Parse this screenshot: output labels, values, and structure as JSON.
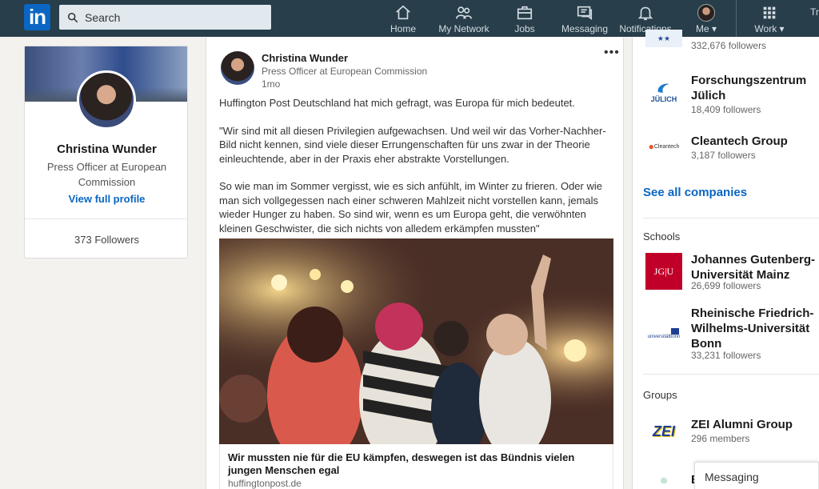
{
  "nav": {
    "search_placeholder": "Search",
    "items": [
      {
        "label": "Home"
      },
      {
        "label": "My Network"
      },
      {
        "label": "Jobs"
      },
      {
        "label": "Messaging"
      },
      {
        "label": "Notifications"
      },
      {
        "label": "Me"
      },
      {
        "label": "Work"
      }
    ],
    "cut_text": "Tr"
  },
  "profile": {
    "name": "Christina Wunder",
    "headline": "Press Officer at European Commission",
    "view_link": "View full profile",
    "followers": "373 Followers"
  },
  "post": {
    "author": "Christina Wunder",
    "author_title": "Press Officer at European Commission",
    "time": "1mo",
    "paragraphs": [
      "Huffington Post Deutschland hat mich gefragt, was Europa für mich bedeutet.",
      "\"Wir sind mit all diesen Privilegien aufgewachsen. Und weil wir das Vorher-Nachher-Bild nicht kennen, sind viele dieser Errungenschaften für uns zwar in der Theorie einleuchtende, aber in der Praxis eher abstrakte Vorstellungen.",
      "So wie man im Sommer vergisst, wie es sich anfühlt, im Winter zu frieren. Oder wie man sich vollgegessen nach einer schweren Mahlzeit nicht vorstellen kann, jemals wieder Hunger zu haben. So sind wir, wenn es um Europa geht, die verwöhnten kleinen Geschwister, die sich nichts von alledem erkämpfen mussten\""
    ],
    "article_title": "Wir mussten nie für die EU kämpfen, deswegen ist das Bündnis vielen jungen Menschen egal",
    "article_source": "huffingtonpost.de"
  },
  "rail": {
    "top_partial_followers": "332,676 followers",
    "companies": [
      {
        "name": "Forschungszentrum Jülich",
        "followers": "18,409 followers",
        "logo_text": "JÜLICH"
      },
      {
        "name": "Cleantech Group",
        "followers": "3,187 followers",
        "logo_text": "Cleantech"
      }
    ],
    "see_all": "See all companies",
    "schools_heading": "Schools",
    "schools": [
      {
        "name": "Johannes Gutenberg-Universität Mainz",
        "followers": "26,699 followers",
        "logo_text": "JG|U"
      },
      {
        "name": "Rheinische Friedrich-Wilhelms-Universität Bonn",
        "followers": "33,231 followers",
        "logo_text": "universitätbonn"
      }
    ],
    "groups_heading": "Groups",
    "groups": [
      {
        "name": "ZEI Alumni Group",
        "members": "296 members",
        "logo_text": "ZEI"
      }
    ],
    "partial_last": "E"
  },
  "messaging": {
    "label": "Messaging"
  },
  "colors": {
    "nav_bg": "#283e4a",
    "brand": "#0a66c2",
    "page_bg": "#f3f2ef"
  }
}
